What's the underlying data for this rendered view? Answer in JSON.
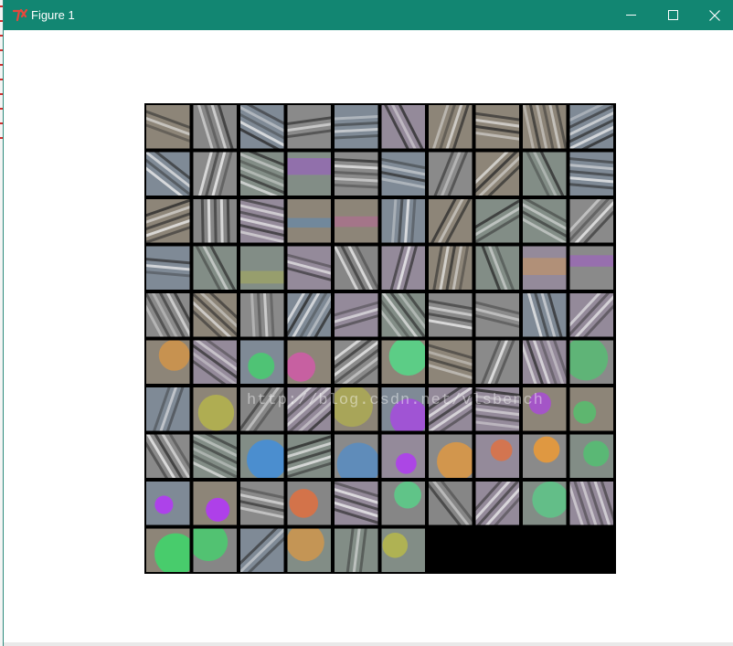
{
  "window": {
    "title": "Figure 1",
    "app_icon": "tk-feather-icon",
    "controls": [
      "minimize-icon",
      "maximize-icon",
      "close-icon"
    ],
    "titlebar_color": "#128672"
  },
  "figure": {
    "kind": "image-grid",
    "rows": 10,
    "cols": 10,
    "filled_cells": 96,
    "empty_cell_color": "#000000",
    "watermark": "http://blog.csdn.net/vlsbench"
  }
}
